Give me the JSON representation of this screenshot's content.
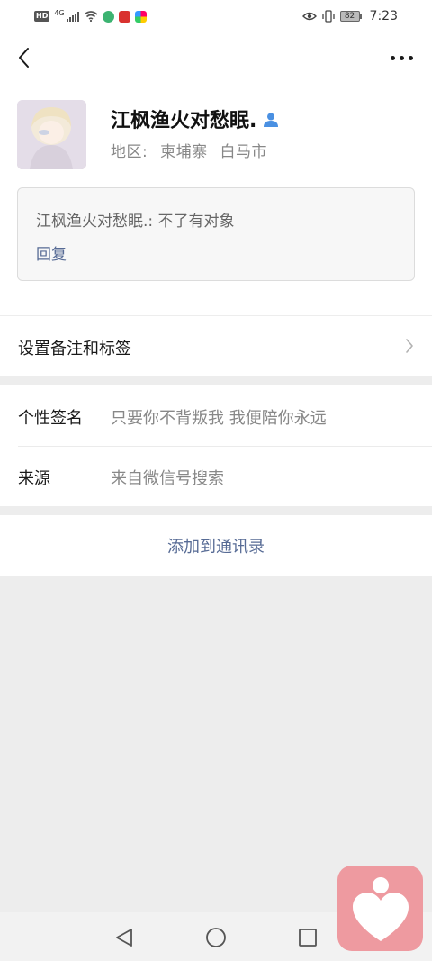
{
  "status_bar": {
    "hd": "HD",
    "network": "4G",
    "battery": "82",
    "time": "7:23"
  },
  "nav": {
    "back_icon": "chevron-left-icon",
    "more_icon": "more-dots-icon"
  },
  "profile": {
    "name": "江枫渔火对愁眠.",
    "region_label": "地区:",
    "region_area": "柬埔寨",
    "region_city": "白马市",
    "greeting": "江枫渔火对愁眠.: 不了有对象",
    "reply_label": "回复"
  },
  "remark": {
    "label": "设置备注和标签"
  },
  "info": {
    "signature_label": "个性签名",
    "signature_value": "只要你不背叛我 我便陪你永远",
    "source_label": "来源",
    "source_value": "来自微信号搜索"
  },
  "actions": {
    "add_contact": "添加到通讯录"
  },
  "colors": {
    "link": "#576b95",
    "background": "#ededed",
    "bubble": "#ee9aa0"
  }
}
